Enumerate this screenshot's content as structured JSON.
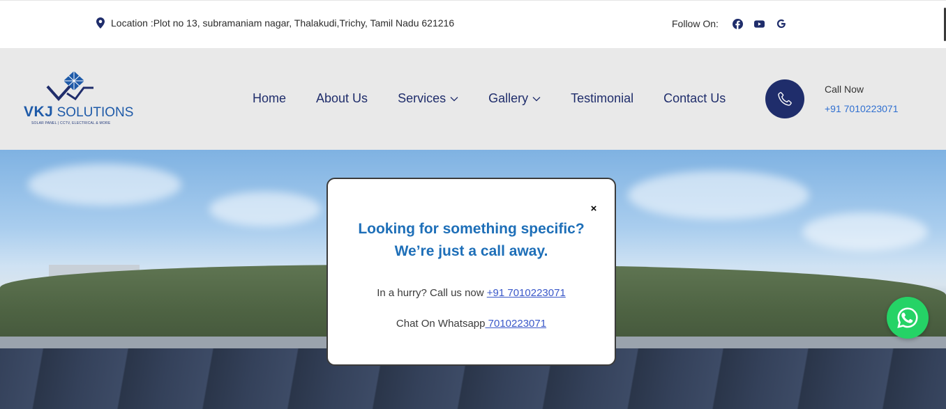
{
  "topbar": {
    "location_icon": "map-pin-icon",
    "location_text": "Location :Plot no 13, subramaniam nagar, Thalakudi,Trichy, Tamil Nadu 621216",
    "follow_label": "Follow On:",
    "social": [
      {
        "icon": "facebook-icon"
      },
      {
        "icon": "youtube-icon"
      },
      {
        "icon": "google-icon"
      }
    ]
  },
  "header": {
    "logo": {
      "brand_bold": "VKJ",
      "brand_rest": " SOLUTIONS",
      "tagline": "SOLAR PANEL | CCTV, ELECTRICAL & MORE"
    },
    "nav": [
      {
        "label": "Home",
        "has_dropdown": false
      },
      {
        "label": "About Us",
        "has_dropdown": false
      },
      {
        "label": "Services",
        "has_dropdown": true
      },
      {
        "label": "Gallery",
        "has_dropdown": true
      },
      {
        "label": "Testimonial",
        "has_dropdown": false
      },
      {
        "label": "Contact Us",
        "has_dropdown": false
      }
    ],
    "call": {
      "icon": "phone-icon",
      "label": "Call Now",
      "number": "+91 7010223071"
    }
  },
  "popup": {
    "close_symbol": "×",
    "heading_line1": "Looking for something specific?",
    "heading_line2": "We’re just a call away.",
    "hurry_text": "In a hurry? Call us now ",
    "hurry_link": "+91 7010223071",
    "whatsapp_text": "Chat On Whatsapp",
    "whatsapp_link": " 7010223071"
  },
  "floating": {
    "whatsapp_icon": "whatsapp-icon"
  },
  "colors": {
    "brand_navy": "#1f2d6b",
    "brand_blue": "#1e6fb8",
    "link_blue": "#2f6fd0",
    "whatsapp_green": "#25d366",
    "header_bg": "#e9e9e9"
  }
}
